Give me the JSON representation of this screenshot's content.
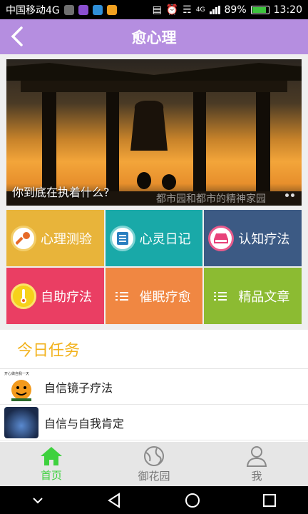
{
  "status_bar": {
    "carrier": "中国移动4G",
    "battery": "89%",
    "time": "13:20",
    "network": "4G"
  },
  "header": {
    "title": "愈心理"
  },
  "banner": {
    "caption": "你到底在执着什么?",
    "watermark": "都市园和都市的精神家园"
  },
  "menu": [
    {
      "label": "心理测验",
      "icon": "key-icon",
      "color": "#e8b43a"
    },
    {
      "label": "心灵日记",
      "icon": "notebook-icon",
      "color": "#19a9a8"
    },
    {
      "label": "认知疗法",
      "icon": "drive-icon",
      "color": "#3c5a84"
    },
    {
      "label": "自助疗法",
      "icon": "thermometer-icon",
      "color": "#ea3e63"
    },
    {
      "label": "催眠疗愈",
      "icon": "list-icon",
      "color": "#f08742"
    },
    {
      "label": "精品文章",
      "icon": "list-icon",
      "color": "#8cbb32"
    }
  ],
  "tasks": {
    "heading": "今日任务",
    "items": [
      {
        "label": "自信镜子疗法",
        "thumb_caption": "开心做自我一天"
      },
      {
        "label": "自信与自我肯定"
      }
    ]
  },
  "tabs": [
    {
      "label": "首页",
      "icon": "home-icon",
      "active": true
    },
    {
      "label": "御花园",
      "icon": "globe-icon",
      "active": false
    },
    {
      "label": "我",
      "icon": "person-icon",
      "active": false
    }
  ],
  "colors": {
    "header": "#b58ee0",
    "accent": "#3ed13e",
    "task_heading": "#f2b21c"
  }
}
